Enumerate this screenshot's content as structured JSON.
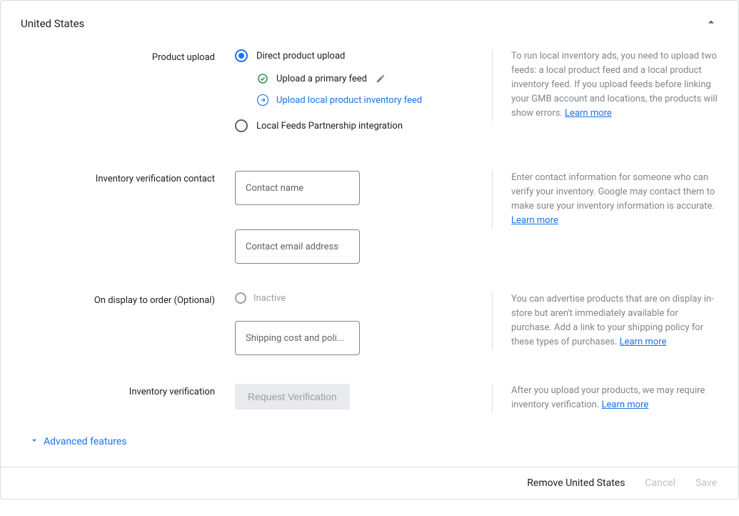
{
  "header": {
    "title": "United States"
  },
  "rows": {
    "productUpload": {
      "label": "Product upload",
      "radio1": "Direct product upload",
      "sub1": "Upload a primary feed",
      "sub2": "Upload local product inventory feed",
      "radio2": "Local Feeds Partnership integration",
      "help": "To run local inventory ads, you need to upload two feeds: a local product feed and a local product inventory feed. If you upload feeds before linking your GMB account and locations, the products will show errors. ",
      "learn": "Learn more"
    },
    "inventoryContact": {
      "label": "Inventory verification contact",
      "placeholder1": "Contact name",
      "placeholder2": "Contact email address",
      "help": "Enter contact information for someone who can verify your inventory. Google may contact them to make sure your inventory information is accurate. ",
      "learn": "Learn more"
    },
    "onDisplay": {
      "label": "On display to order (Optional)",
      "toggle": "Inactive",
      "placeholder": "Shipping cost and poli...",
      "help": "You can advertise products that are on display in-store but aren't immediately available for purchase. Add a link to your shipping policy for these types of purchases. ",
      "learn": "Learn more"
    },
    "inventoryVerification": {
      "label": "Inventory verification",
      "button": "Request Verification",
      "help": "After you upload your products, we may require inventory verification. ",
      "learn": "Learn more"
    }
  },
  "advanced": "Advanced features",
  "footer": {
    "remove": "Remove United States",
    "cancel": "Cancel",
    "save": "Save"
  }
}
